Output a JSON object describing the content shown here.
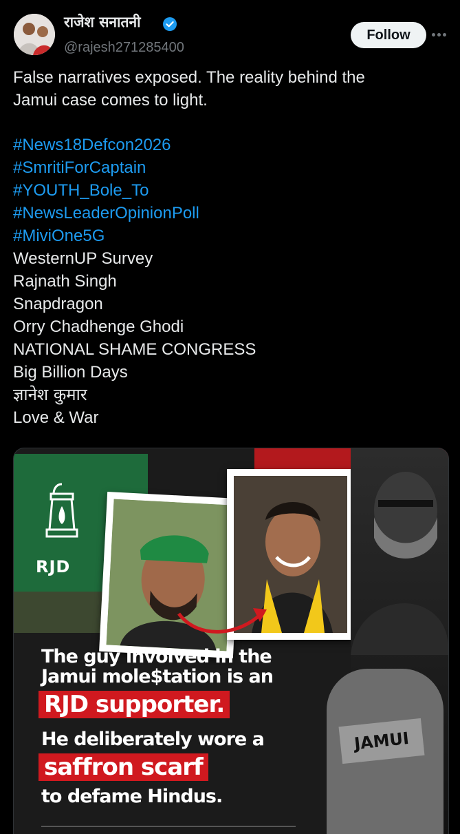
{
  "author": {
    "name": "राजेश सनातनी",
    "handle": "@rajesh271285400",
    "verified": true,
    "follow_label": "Follow",
    "verified_color": "#1d9bf0"
  },
  "post": {
    "text_lines": [
      "False narratives exposed. The reality behind the",
      "Jamui case comes to light."
    ],
    "hashtags": [
      "#News18Defcon2026",
      "#SmritiForCaptain",
      "#YOUTH_Bole_To",
      "#NewsLeaderOpinionPoll",
      "#MiviOne5G"
    ],
    "plain_lines": [
      "WesternUP Survey",
      "Rajnath Singh",
      "Snapdragon",
      "Orry Chadhenge Ghodi",
      "NATIONAL SHAME CONGRESS",
      "Big Billion Days",
      "ज्ञानेश कुमार",
      "Love & War"
    ]
  },
  "media": {
    "flag_text": "RJD",
    "headline_1a": "The guy involved in the",
    "headline_1b": "Jamui mole$tation is an",
    "highlight_1": "RJD supporter.",
    "headline_2": "He deliberately wore a",
    "highlight_2": "saffron scarf",
    "headline_3": "to defame Hindus.",
    "gate_label": "JAMUI"
  },
  "colors": {
    "background": "#000000",
    "link": "#1d9bf0",
    "highlight_red": "#d0191f"
  }
}
